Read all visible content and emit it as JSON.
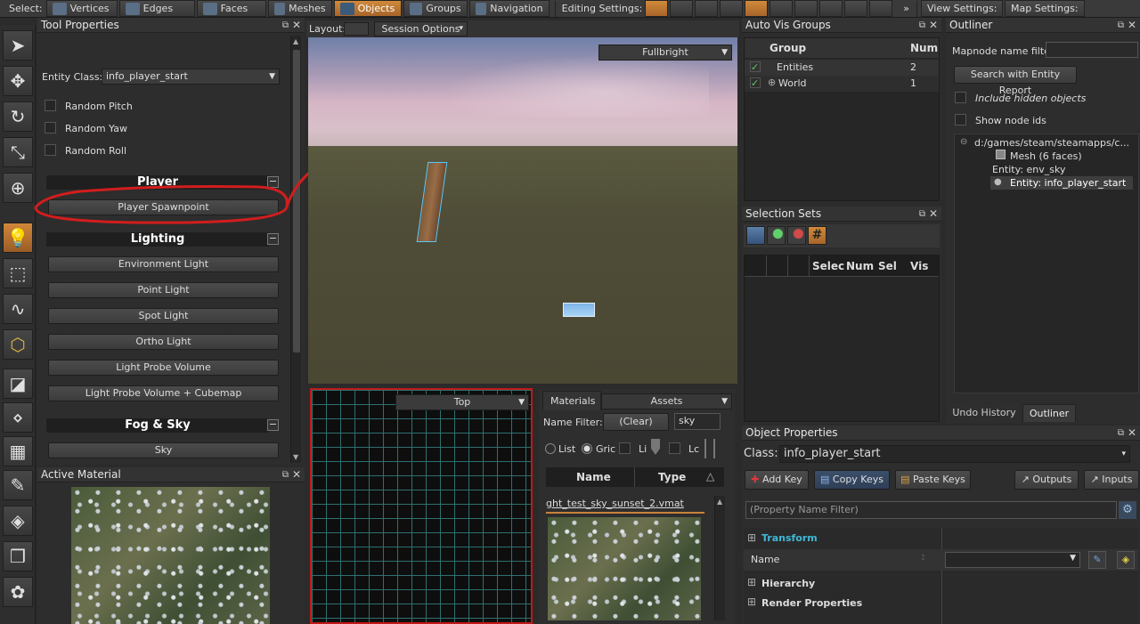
{
  "toolbar": {
    "select_label": "Select:",
    "modes": [
      "Vertices",
      "Edges",
      "Faces",
      "Meshes",
      "Objects",
      "Groups",
      "Navigation"
    ],
    "editing_settings_label": "Editing Settings:",
    "more_label": "»",
    "view_settings_label": "View Settings:",
    "map_settings_label": "Map Settings:"
  },
  "tool_properties": {
    "title": "Tool Properties",
    "entity_class_label": "Entity Class:",
    "entity_class_value": "info_player_start",
    "checkboxes": [
      "Random Pitch",
      "Random Yaw",
      "Random Roll"
    ],
    "sections": [
      {
        "title": "Player",
        "items": [
          "Player Spawnpoint"
        ]
      },
      {
        "title": "Lighting",
        "items": [
          "Environment Light",
          "Point Light",
          "Spot Light",
          "Ortho Light",
          "Light Probe Volume",
          "Light Probe Volume + Cubemap"
        ]
      },
      {
        "title": "Fog & Sky",
        "items": [
          "Sky"
        ]
      }
    ]
  },
  "active_material": {
    "title": "Active Material"
  },
  "viewport": {
    "layout_label": "Layout:",
    "session_options_label": "Session Options",
    "render_mode": "Fullbright",
    "top_view_label": "Top"
  },
  "materials": {
    "tab_materials": "Materials",
    "tab_assets": "Assets",
    "name_filter_label": "Name Filter:",
    "clear_label": "(Clear)",
    "filter_value": "sky",
    "view_list": "List",
    "view_grid": "Gric",
    "opt_li": "Li",
    "opt_lc": "Lc",
    "col_name": "Name",
    "col_type": "Type",
    "item_name": "ght_test_sky_sunset_2.vmat"
  },
  "auto_vis": {
    "title": "Auto Vis Groups",
    "col_group": "Group",
    "col_num": "Num",
    "rows": [
      {
        "name": "Entities",
        "num": "2"
      },
      {
        "name": "World",
        "num": "1"
      }
    ]
  },
  "selection_sets": {
    "title": "Selection Sets",
    "cols": [
      "Selec",
      "Num",
      "Sel",
      "Vis"
    ]
  },
  "outliner": {
    "title": "Outliner",
    "filter_label": "Mapnode name filter",
    "search_button": "Search with Entity Report",
    "include_hidden": "Include hidden objects",
    "show_node_ids": "Show node ids",
    "tree_root": "d:/games/steam/steamapps/c...",
    "tree_items": [
      "Mesh (6 faces)",
      "Entity: env_sky",
      "Entity: info_player_start"
    ],
    "tabs": [
      "Undo History",
      "Outliner"
    ]
  },
  "object_properties": {
    "title": "Object Properties",
    "class_label": "Class:",
    "class_value": "info_player_start",
    "buttons": [
      "Add Key",
      "Copy Keys",
      "Paste Keys",
      "Outputs",
      "Inputs"
    ],
    "filter_placeholder": "(Property Name Filter)",
    "groups": [
      "Transform",
      "Hierarchy",
      "Render Properties"
    ],
    "name_row_label": "Name"
  },
  "colors": {
    "accent_orange": "#c9823a",
    "highlight_red": "#d21d1d",
    "teal_heading": "#3fb8d8"
  }
}
